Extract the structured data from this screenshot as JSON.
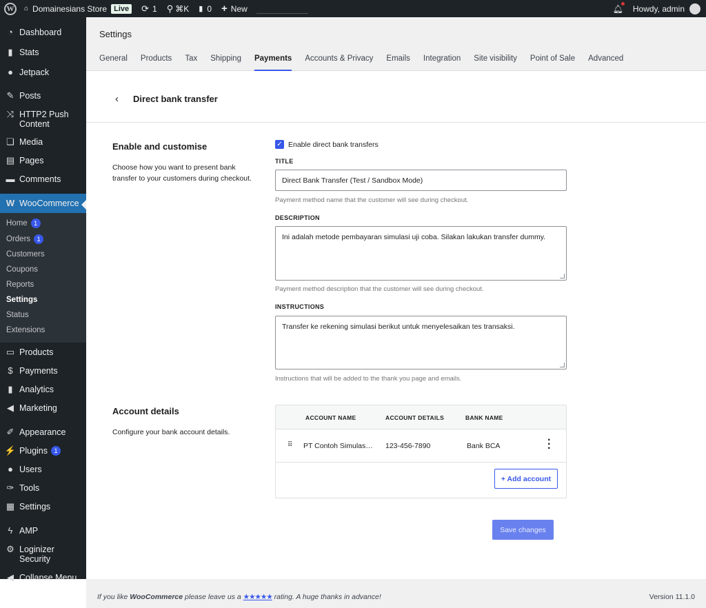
{
  "adminbar": {
    "site_name": "Domainesians Store",
    "live_badge": "Live",
    "updates_count": "1",
    "search_shortcut": "⌘K",
    "comments_count": "0",
    "new_label": "New",
    "howdy": "Howdy, admin"
  },
  "sidebar": {
    "items_top": [
      {
        "label": "Dashboard",
        "icon": "dashboard-icon"
      },
      {
        "label": "Stats",
        "icon": "stats-icon"
      },
      {
        "label": "Jetpack",
        "icon": "jetpack-icon"
      }
    ],
    "items_mid": [
      {
        "label": "Posts",
        "icon": "pin-icon"
      },
      {
        "label": "HTTP2 Push Content",
        "icon": "shuffle-icon"
      },
      {
        "label": "Media",
        "icon": "media-icon"
      },
      {
        "label": "Pages",
        "icon": "pages-icon"
      },
      {
        "label": "Comments",
        "icon": "comments-icon"
      }
    ],
    "woocommerce": "WooCommerce",
    "submenu": [
      {
        "label": "Home",
        "badge": "1"
      },
      {
        "label": "Orders",
        "badge": "1"
      },
      {
        "label": "Customers",
        "badge": ""
      },
      {
        "label": "Coupons",
        "badge": ""
      },
      {
        "label": "Reports",
        "badge": ""
      },
      {
        "label": "Settings",
        "badge": ""
      },
      {
        "label": "Status",
        "badge": ""
      },
      {
        "label": "Extensions",
        "badge": ""
      }
    ],
    "items_after_wc": [
      {
        "label": "Products",
        "icon": "products-icon"
      },
      {
        "label": "Payments",
        "icon": "payments-icon"
      },
      {
        "label": "Analytics",
        "icon": "analytics-icon"
      },
      {
        "label": "Marketing",
        "icon": "megaphone-icon"
      }
    ],
    "items_admin": [
      {
        "label": "Appearance",
        "icon": "brush-icon"
      },
      {
        "label": "Plugins",
        "icon": "plugins-icon",
        "badge": "1"
      },
      {
        "label": "Users",
        "icon": "users-icon"
      },
      {
        "label": "Tools",
        "icon": "tools-icon"
      },
      {
        "label": "Settings",
        "icon": "settings-icon"
      }
    ],
    "items_bottom": [
      {
        "label": "AMP",
        "icon": "amp-icon"
      },
      {
        "label": "Loginizer Security",
        "icon": "gear-icon"
      },
      {
        "label": "Collapse Menu",
        "icon": "collapse-icon"
      }
    ]
  },
  "header": {
    "title": "Settings",
    "tabs": [
      "General",
      "Products",
      "Tax",
      "Shipping",
      "Payments",
      "Accounts & Privacy",
      "Emails",
      "Integration",
      "Site visibility",
      "Point of Sale",
      "Advanced"
    ],
    "active_tab": "Payments"
  },
  "page": {
    "title": "Direct bank transfer"
  },
  "enable_section": {
    "title": "Enable and customise",
    "description": "Choose how you want to present bank transfer to your customers during checkout.",
    "checkbox_label": "Enable direct bank transfers",
    "title_label": "TITLE",
    "title_value": "Direct Bank Transfer (Test / Sandbox Mode)",
    "title_help": "Payment method name that the customer will see during checkout.",
    "description_label": "DESCRIPTION",
    "description_value": "Ini adalah metode pembayaran simulasi uji coba. Silakan lakukan transfer dummy.",
    "description_help": "Payment method description that the customer will see during checkout.",
    "instructions_label": "INSTRUCTIONS",
    "instructions_value": "Transfer ke rekening simulasi berikut untuk menyelesaikan tes transaksi.",
    "instructions_help": "Instructions that will be added to the thank you page and emails."
  },
  "account_section": {
    "title": "Account details",
    "description": "Configure your bank account details.",
    "columns": [
      "ACCOUNT NAME",
      "ACCOUNT DETAILS",
      "BANK NAME"
    ],
    "rows": [
      {
        "account_name": "PT Contoh Simulas…",
        "account_details": "123-456-7890",
        "bank_name": "Bank BCA"
      }
    ],
    "add_button": "+ Add account"
  },
  "save_button": "Save changes",
  "footer": {
    "pre": "If you like ",
    "brand": "WooCommerce",
    "mid": " please leave us a ",
    "stars": "★★★★★",
    "post": " rating. A huge thanks in advance!",
    "version": "Version 11.1.0"
  },
  "colors": {
    "accent": "#3858e9",
    "sidebar_bg": "#1d2327",
    "wc_current": "#2271b1"
  }
}
